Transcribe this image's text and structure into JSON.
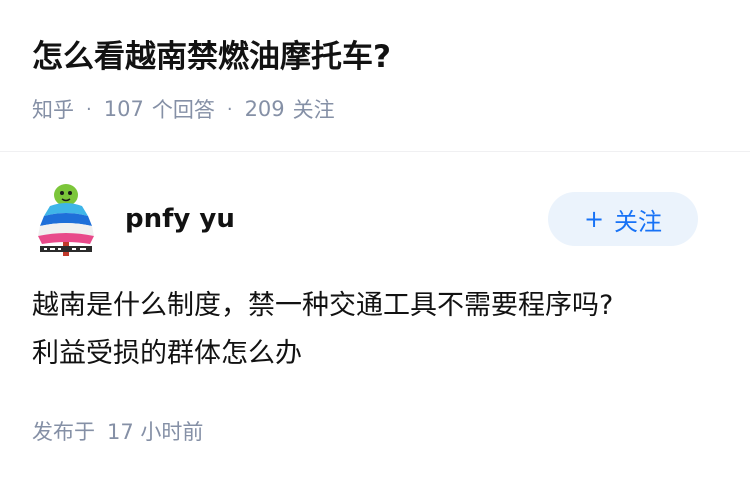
{
  "question": {
    "title": "怎么看越南禁燃油摩托车?",
    "source": "知乎",
    "separator": "·",
    "answer_count": "107",
    "answer_label": "个回答",
    "follower_count": "209",
    "follower_label": "关注"
  },
  "answer": {
    "author_name": "pnfy yu",
    "follow_button_label": "关注",
    "follow_button_icon": "plus-icon",
    "content_lines": [
      "越南是什么制度，禁一种交通工具不需要程序吗?",
      "利益受损的群体怎么办"
    ],
    "published_label": "发布于",
    "published_time": "17 小时前"
  },
  "colors": {
    "text_primary": "#121212",
    "text_secondary": "#8590a6",
    "accent_blue": "#1772f6",
    "follow_button_bg": "#ebf3fc"
  }
}
